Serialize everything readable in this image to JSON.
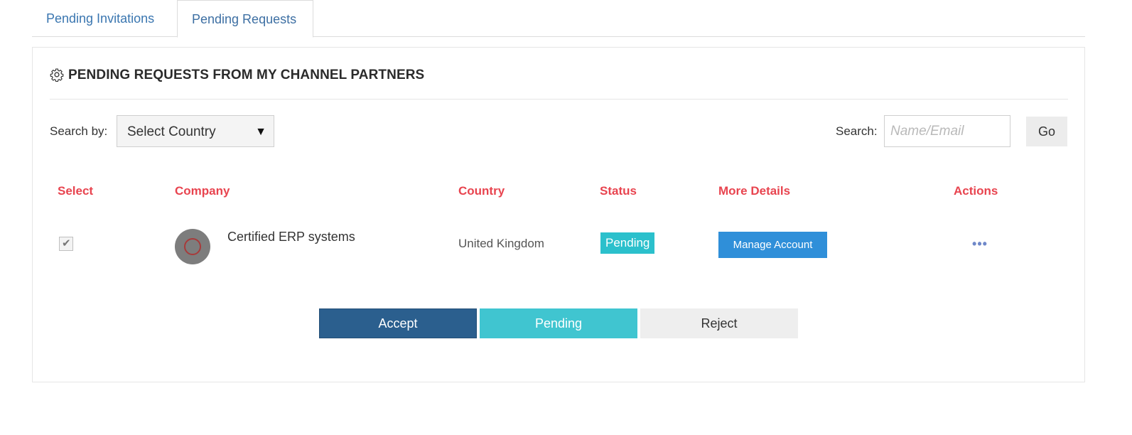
{
  "tabs": [
    {
      "label": "Pending Invitations",
      "active": false
    },
    {
      "label": "Pending Requests",
      "active": true
    }
  ],
  "panel": {
    "title": "PENDING REQUESTS FROM MY CHANNEL PARTNERS",
    "title_icon": "gear-icon"
  },
  "filters": {
    "search_by_label": "Search by:",
    "country_select_value": "Select Country",
    "search_label": "Search:",
    "search_placeholder": "Name/Email",
    "go_label": "Go"
  },
  "table": {
    "headers": [
      "Select",
      "Company",
      "Country",
      "Status",
      "More Details",
      "Actions"
    ],
    "rows": [
      {
        "selected": true,
        "company": "Certified ERP systems",
        "country": "United Kingdom",
        "status": "Pending",
        "details_button": "Manage Account",
        "actions_icon": "more-dots-icon"
      }
    ]
  },
  "actions": {
    "accept": "Accept",
    "pending": "Pending",
    "reject": "Reject"
  },
  "colors": {
    "header_accent": "#e8444f",
    "tab_text": "#3a76b0",
    "status_pending": "#2bc0cc",
    "manage_button": "#2f8fd9",
    "accept_button": "#2b5f8e",
    "pending_button": "#40c5d0",
    "reject_button": "#eeeeee"
  }
}
